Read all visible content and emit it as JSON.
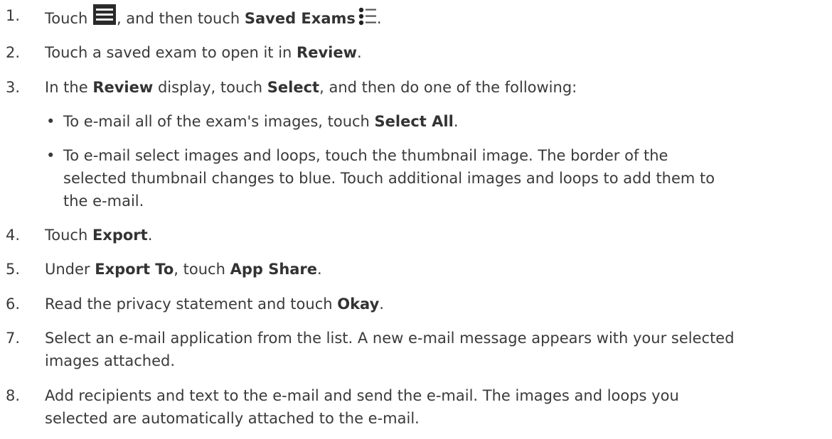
{
  "steps": [
    {
      "num": "1.",
      "pre": "Touch ",
      "mid": ", and then touch ",
      "bold": "Saved Exams",
      "post": "."
    },
    {
      "num": "2.",
      "pre": "Touch a saved exam to open it in ",
      "bold": "Review",
      "post": "."
    },
    {
      "num": "3.",
      "pre": "In the ",
      "bold1": "Review",
      "mid": " display, touch ",
      "bold2": "Select",
      "post": ", and then do one of the following:"
    },
    {
      "num": "4.",
      "pre": "Touch ",
      "bold": "Export",
      "post": "."
    },
    {
      "num": "5.",
      "pre": "Under ",
      "bold1": "Export To",
      "mid": ", touch ",
      "bold2": "App Share",
      "post": "."
    },
    {
      "num": "6.",
      "pre": "Read the privacy statement and touch ",
      "bold": "Okay",
      "post": "."
    },
    {
      "num": "7.",
      "line1": "Select an e-mail application from the list. A new e-mail message appears with your selected",
      "line2": "images attached."
    },
    {
      "num": "8.",
      "line1": "Add recipients and text to the e-mail and send the e-mail. The images and loops you",
      "line2": "selected are automatically attached to the e-mail."
    }
  ],
  "bullets": [
    {
      "bullet": "•",
      "pre": "To e-mail all of the exam's images, touch ",
      "bold": "Select All",
      "post": "."
    },
    {
      "bullet": "•",
      "line1": "To e-mail select images and loops, touch the thumbnail image. The border of the",
      "line2": "selected thumbnail changes to blue. Touch additional images and loops to add them to",
      "line3": "the e-mail."
    }
  ],
  "icons": {
    "menu": "menu-icon",
    "saved_exams": "list-icon"
  }
}
